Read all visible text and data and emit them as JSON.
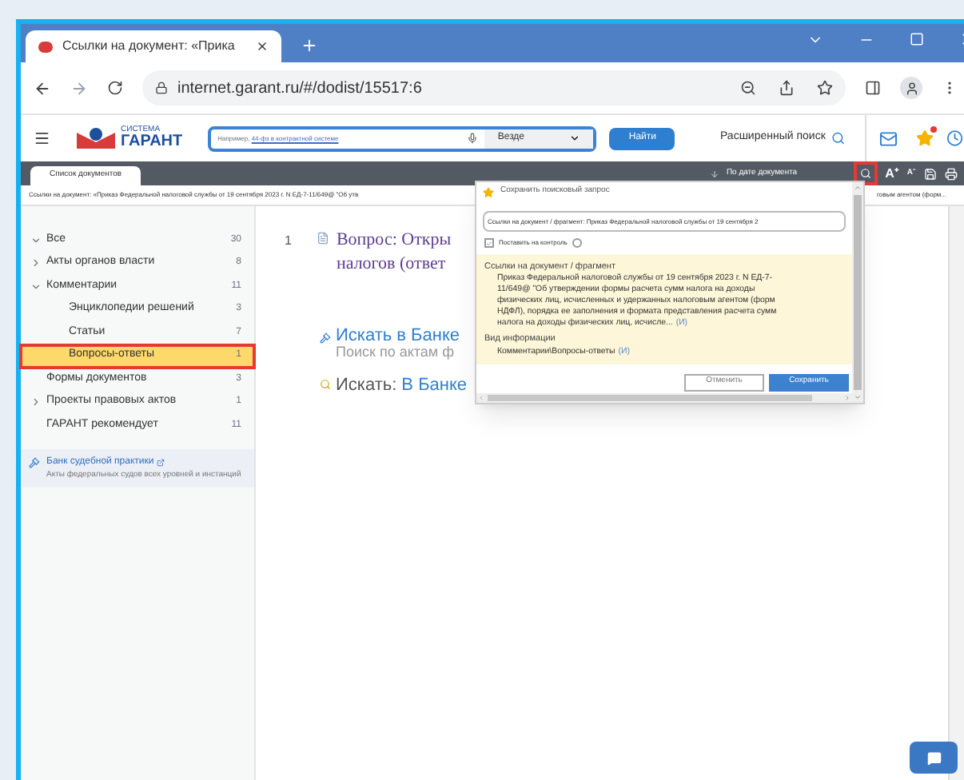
{
  "browser": {
    "tab_title": "Ссылки на документ: «Прика",
    "url": "internet.garant.ru/#/dodist/15517:6"
  },
  "header": {
    "logo_small": "СИСТЕМА",
    "logo": "ГАРАНТ",
    "search_hint": "Например,",
    "search_placeholder": "44-фз в контрактной системе",
    "scope": "Везде",
    "search_button": "Найти",
    "advanced_search": "Расширенный поиск"
  },
  "toolbar": {
    "tabs": [
      {
        "label": "Список документов",
        "selected": true
      }
    ],
    "sort": "По дате документа",
    "font_larger": "A⁺",
    "font_smaller": "A⁻"
  },
  "breadcrumb": {
    "left": "Ссылки на документ: «Приказ Федеральной налоговой службы от 19 сентября 2023 г. N ЕД-7-11/649@ \"Об утв",
    "right": "говым агентом (форм..."
  },
  "sidebar": {
    "items": [
      {
        "label": "Все",
        "count": "30",
        "expanded": true,
        "selected": false
      },
      {
        "label": "Акты органов власти",
        "count": "8",
        "expanded": false,
        "selected": false
      },
      {
        "label": "Комментарии",
        "count": "11",
        "expanded": true,
        "selected": false,
        "children": [
          {
            "label": "Энциклопедии решений",
            "count": "3",
            "selected": false
          },
          {
            "label": "Статьи",
            "count": "7",
            "selected": false
          },
          {
            "label": "Вопросы-ответы",
            "count": "1",
            "selected": true
          }
        ]
      },
      {
        "label": "Формы документов",
        "count": "3",
        "selected": false
      },
      {
        "label": "Проекты правовых актов",
        "count": "1",
        "expanded": false,
        "selected": false
      },
      {
        "label": "ГАРАНТ рекомендует",
        "count": "11",
        "selected": false
      }
    ],
    "bank": {
      "title": "Банк судебной практики",
      "description": "Акты федеральных судов всех уровней и инстанций"
    }
  },
  "results": [
    {
      "number": "1",
      "title_lines": [
        "Вопрос: Откры",
        "налогов (ответ"
      ]
    }
  ],
  "bank_search": {
    "title": "Искать в Банке",
    "subtitle": "Поиск по актам ф"
  },
  "search_in": {
    "label": "Искать:",
    "link": "В Банке"
  },
  "dialog": {
    "title": "Сохранить поисковый запрос",
    "name_value": "Ссылки на документ / фрагмент: Приказ Федеральной налоговой службы от 19 сентября 2",
    "control_label": "Поставить на контроль",
    "control_checked": true,
    "sections": [
      {
        "heading": "Ссылки на документ / фрагмент",
        "lines": [
          "Приказ Федеральной налоговой службы от 19 сентября 2023 г. N ЕД-7-",
          "11/649@ \"Об утверждении формы расчета сумм налога на доходы",
          "физических лиц, исчисленных и удержанных налоговым агентом (форм",
          "НДФЛ), порядка ее заполнения и формата представления расчета сумм",
          "налога на доходы физических лиц, исчисле..."
        ],
        "link": "(И)"
      },
      {
        "heading": "Вид информации",
        "lines": [
          "Комментарии\\Вопросы-ответы"
        ],
        "link": "(И)"
      }
    ],
    "buttons": [
      {
        "label": "Отменить",
        "kind": "secondary"
      },
      {
        "label": "Сохранить",
        "kind": "primary"
      }
    ]
  }
}
